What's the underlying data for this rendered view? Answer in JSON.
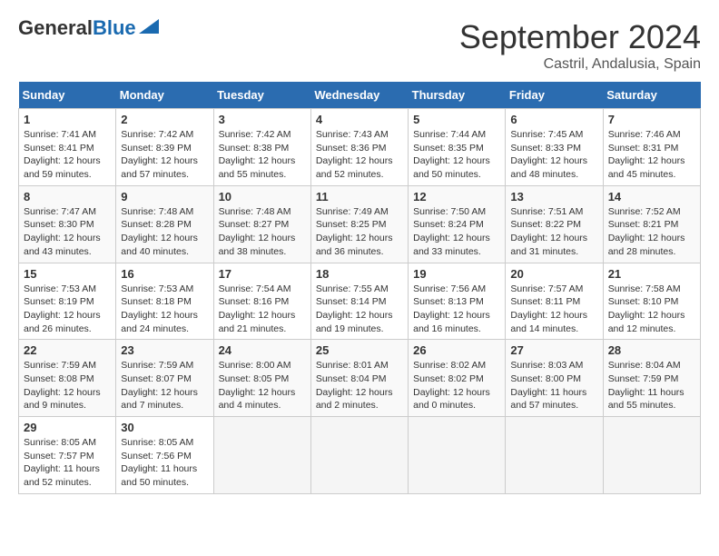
{
  "header": {
    "logo_general": "General",
    "logo_blue": "Blue",
    "month": "September 2024",
    "location": "Castril, Andalusia, Spain"
  },
  "weekdays": [
    "Sunday",
    "Monday",
    "Tuesday",
    "Wednesday",
    "Thursday",
    "Friday",
    "Saturday"
  ],
  "weeks": [
    [
      {
        "day": "1",
        "sunrise": "7:41 AM",
        "sunset": "8:41 PM",
        "daylight": "12 hours and 59 minutes."
      },
      {
        "day": "2",
        "sunrise": "7:42 AM",
        "sunset": "8:39 PM",
        "daylight": "12 hours and 57 minutes."
      },
      {
        "day": "3",
        "sunrise": "7:42 AM",
        "sunset": "8:38 PM",
        "daylight": "12 hours and 55 minutes."
      },
      {
        "day": "4",
        "sunrise": "7:43 AM",
        "sunset": "8:36 PM",
        "daylight": "12 hours and 52 minutes."
      },
      {
        "day": "5",
        "sunrise": "7:44 AM",
        "sunset": "8:35 PM",
        "daylight": "12 hours and 50 minutes."
      },
      {
        "day": "6",
        "sunrise": "7:45 AM",
        "sunset": "8:33 PM",
        "daylight": "12 hours and 48 minutes."
      },
      {
        "day": "7",
        "sunrise": "7:46 AM",
        "sunset": "8:31 PM",
        "daylight": "12 hours and 45 minutes."
      }
    ],
    [
      {
        "day": "8",
        "sunrise": "7:47 AM",
        "sunset": "8:30 PM",
        "daylight": "12 hours and 43 minutes."
      },
      {
        "day": "9",
        "sunrise": "7:48 AM",
        "sunset": "8:28 PM",
        "daylight": "12 hours and 40 minutes."
      },
      {
        "day": "10",
        "sunrise": "7:48 AM",
        "sunset": "8:27 PM",
        "daylight": "12 hours and 38 minutes."
      },
      {
        "day": "11",
        "sunrise": "7:49 AM",
        "sunset": "8:25 PM",
        "daylight": "12 hours and 36 minutes."
      },
      {
        "day": "12",
        "sunrise": "7:50 AM",
        "sunset": "8:24 PM",
        "daylight": "12 hours and 33 minutes."
      },
      {
        "day": "13",
        "sunrise": "7:51 AM",
        "sunset": "8:22 PM",
        "daylight": "12 hours and 31 minutes."
      },
      {
        "day": "14",
        "sunrise": "7:52 AM",
        "sunset": "8:21 PM",
        "daylight": "12 hours and 28 minutes."
      }
    ],
    [
      {
        "day": "15",
        "sunrise": "7:53 AM",
        "sunset": "8:19 PM",
        "daylight": "12 hours and 26 minutes."
      },
      {
        "day": "16",
        "sunrise": "7:53 AM",
        "sunset": "8:18 PM",
        "daylight": "12 hours and 24 minutes."
      },
      {
        "day": "17",
        "sunrise": "7:54 AM",
        "sunset": "8:16 PM",
        "daylight": "12 hours and 21 minutes."
      },
      {
        "day": "18",
        "sunrise": "7:55 AM",
        "sunset": "8:14 PM",
        "daylight": "12 hours and 19 minutes."
      },
      {
        "day": "19",
        "sunrise": "7:56 AM",
        "sunset": "8:13 PM",
        "daylight": "12 hours and 16 minutes."
      },
      {
        "day": "20",
        "sunrise": "7:57 AM",
        "sunset": "8:11 PM",
        "daylight": "12 hours and 14 minutes."
      },
      {
        "day": "21",
        "sunrise": "7:58 AM",
        "sunset": "8:10 PM",
        "daylight": "12 hours and 12 minutes."
      }
    ],
    [
      {
        "day": "22",
        "sunrise": "7:59 AM",
        "sunset": "8:08 PM",
        "daylight": "12 hours and 9 minutes."
      },
      {
        "day": "23",
        "sunrise": "7:59 AM",
        "sunset": "8:07 PM",
        "daylight": "12 hours and 7 minutes."
      },
      {
        "day": "24",
        "sunrise": "8:00 AM",
        "sunset": "8:05 PM",
        "daylight": "12 hours and 4 minutes."
      },
      {
        "day": "25",
        "sunrise": "8:01 AM",
        "sunset": "8:04 PM",
        "daylight": "12 hours and 2 minutes."
      },
      {
        "day": "26",
        "sunrise": "8:02 AM",
        "sunset": "8:02 PM",
        "daylight": "12 hours and 0 minutes."
      },
      {
        "day": "27",
        "sunrise": "8:03 AM",
        "sunset": "8:00 PM",
        "daylight": "11 hours and 57 minutes."
      },
      {
        "day": "28",
        "sunrise": "8:04 AM",
        "sunset": "7:59 PM",
        "daylight": "11 hours and 55 minutes."
      }
    ],
    [
      {
        "day": "29",
        "sunrise": "8:05 AM",
        "sunset": "7:57 PM",
        "daylight": "11 hours and 52 minutes."
      },
      {
        "day": "30",
        "sunrise": "8:05 AM",
        "sunset": "7:56 PM",
        "daylight": "11 hours and 50 minutes."
      },
      null,
      null,
      null,
      null,
      null
    ]
  ]
}
